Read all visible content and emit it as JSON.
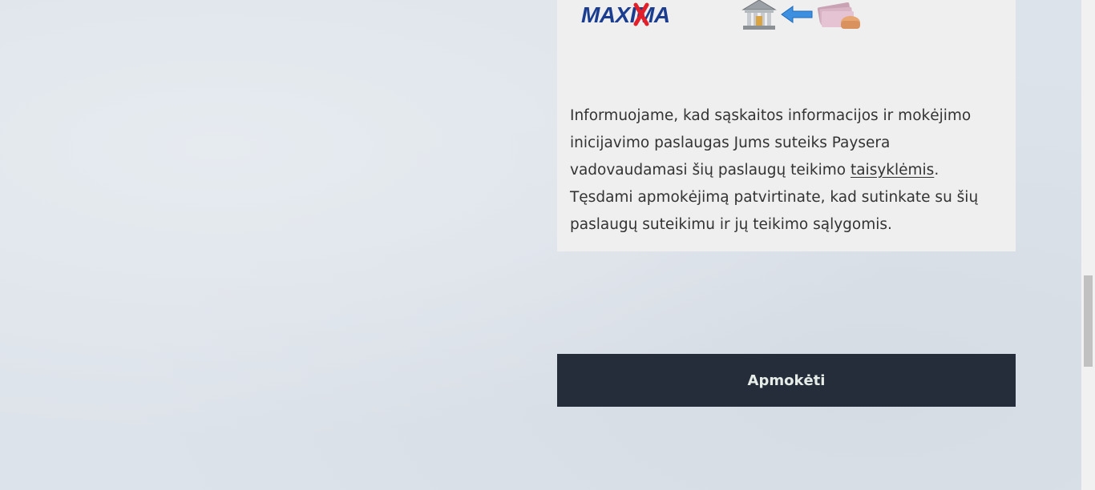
{
  "logos": {
    "merchant_name": "MAXIMA",
    "merchant_icon": "maxima-logo",
    "bank_icon": "bank-icon",
    "arrow_icon": "arrow-left-icon",
    "cash_icon": "cash-icon"
  },
  "info": {
    "text_before_link": "Informuojame, kad sąskaitos informacijos ir mokėjimo inicijavimo paslaugas Jums suteiks Paysera vadovaudamasi šių paslaugų teikimo ",
    "link_text": "taisyklėmis",
    "text_after_link": ". Tęsdami apmokėjimą patvirtinate, kad sutinkate su šių paslaugų suteikimu ir jų teikimo sąlygomis."
  },
  "pay_button": {
    "label": "Apmokėti"
  },
  "colors": {
    "page_background": "#dde3ea",
    "card_background": "#efefef",
    "button_background": "#262d3a",
    "button_text": "#e6ece7",
    "maxima_blue": "#1a3d8f",
    "maxima_red": "#e3202a"
  }
}
